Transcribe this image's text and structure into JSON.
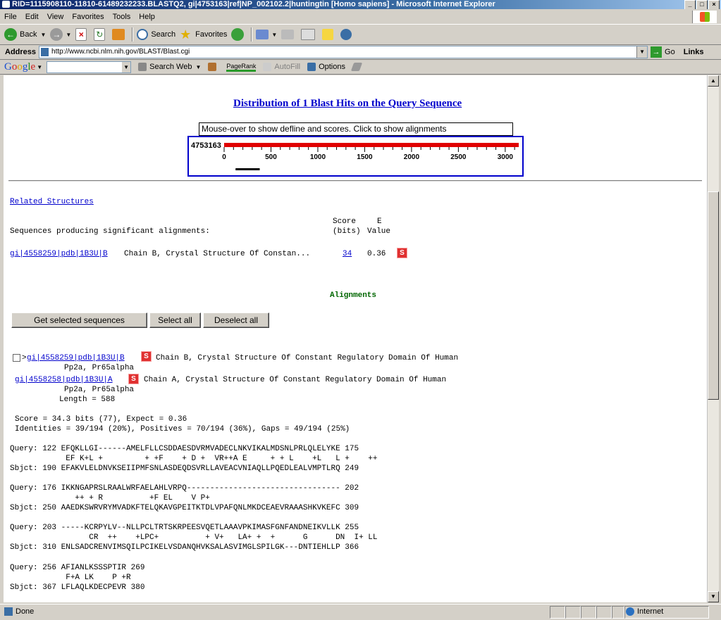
{
  "window": {
    "title": "RID=1115908110-11810-61489232233.BLASTQ2, gi|4753163|ref|NP_002102.2|huntingtin [Homo sapiens] - Microsoft Internet Explorer"
  },
  "menu": [
    "File",
    "Edit",
    "View",
    "Favorites",
    "Tools",
    "Help"
  ],
  "toolbar": {
    "back": "Back",
    "search": "Search",
    "favorites": "Favorites"
  },
  "address": {
    "label": "Address",
    "url": "http://www.ncbi.nlm.nih.gov/BLAST/Blast.cgi",
    "go": "Go",
    "links": "Links"
  },
  "google": {
    "logo": [
      "G",
      "o",
      "o",
      "g",
      "l",
      "e"
    ],
    "search_web": "Search Web",
    "pagerank": "PageRank",
    "autofill": "AutoFill",
    "options": "Options"
  },
  "colors": {
    "link": "#0000cc",
    "hit_bar": "#e00000",
    "alignments_heading": "#006600",
    "badge": "#e03030"
  },
  "distribution": {
    "title": "Distribution of 1 Blast Hits on the Query Sequence",
    "mouseover_text": "Mouse-over to show defline and scores. Click to show alignments",
    "query_id": "4753163",
    "scale_labels": [
      "0",
      "500",
      "1000",
      "1500",
      "2000",
      "2500",
      "3000"
    ],
    "scale_max": 3144,
    "hit_range": [
      122,
      380
    ]
  },
  "related_structures": "Related Structures",
  "summary": {
    "score_header_1": "Score",
    "score_header_2": "(bits)",
    "e_header_1": "E",
    "e_header_2": "Value",
    "producing_label": "Sequences producing significant alignments:",
    "hits": [
      {
        "id": "gi|4558259|pdb|1B3U|B",
        "description": "Chain B, Crystal Structure Of Constan...",
        "score": "34",
        "evalue": "0.36",
        "badge": "S"
      }
    ]
  },
  "alignments_heading": "Alignments",
  "buttons": {
    "get_selected": "Get selected sequences",
    "select_all": "Select all",
    "deselect_all": "Deselect all"
  },
  "alignment": {
    "prefix": ">",
    "id1": "gi|4558259|pdb|1B3U|B",
    "desc1": "Chain B, Crystal Structure Of Constant Regulatory Domain Of Human",
    "desc1_cont": "Pp2a, Pr65alpha",
    "id2": "gi|4558258|pdb|1B3U|A",
    "desc2": "Chain A, Crystal Structure Of Constant Regulatory Domain Of Human",
    "desc2_cont": "Pp2a, Pr65alpha",
    "length": "Length = 588",
    "score_line": "Score = 34.3 bits (77), Expect = 0.36",
    "identities_line": "Identities = 39/194 (20%), Positives = 70/194 (36%), Gaps = 49/194 (25%)",
    "blocks": [
      {
        "query": "Query: 122 EFQKLLGI------AMELFLLCSDDAESDVRMVADECLNKVIKALMDSNLPRLQLELYKE 175",
        "match": "            EF K+L +         + +F    + D +  VR++A E     + + L    +L   L +    ++",
        "sbjct": "Sbjct: 190 EFAKVLELDNVKSEIIPMFSNLASDEQDSVRLLAVEACVNIAQLLPQEDLEALVMPTLRQ 249"
      },
      {
        "query": "Query: 176 IKKNGAPRSLRAALWRFAELAHLVRPQ--------------------------------- 202",
        "match": "              ++ + R          +F EL    V P+",
        "sbjct": "Sbjct: 250 AAEDKSWRVRYMVADKFTELQKAVGPEITKTDLVPAFQNLMKDCEAEVRAAASHKVKEFC 309"
      },
      {
        "query": "Query: 203 -----KCRPYLV--NLLPCLTRTSKRPEESVQETLAAAVPKIMASFGNFANDNEIKVLLK 255",
        "match": "                 CR  ++    +LPC+          + V+   LA+ +  +      G      DN  I+ LL",
        "sbjct": "Sbjct: 310 ENLSADCRENVIMSQILPCIKELVSDANQHVKSALASVIMGLSPILGK---DNTIEHLLP 366"
      },
      {
        "query": "Query: 256 AFIANLKSSSPTIR 269",
        "match": "            F+A LK    P +R",
        "sbjct": "Sbjct: 367 LFLAQLKDECPEVR 380"
      }
    ]
  },
  "status": {
    "text": "Done",
    "zone": "Internet"
  }
}
